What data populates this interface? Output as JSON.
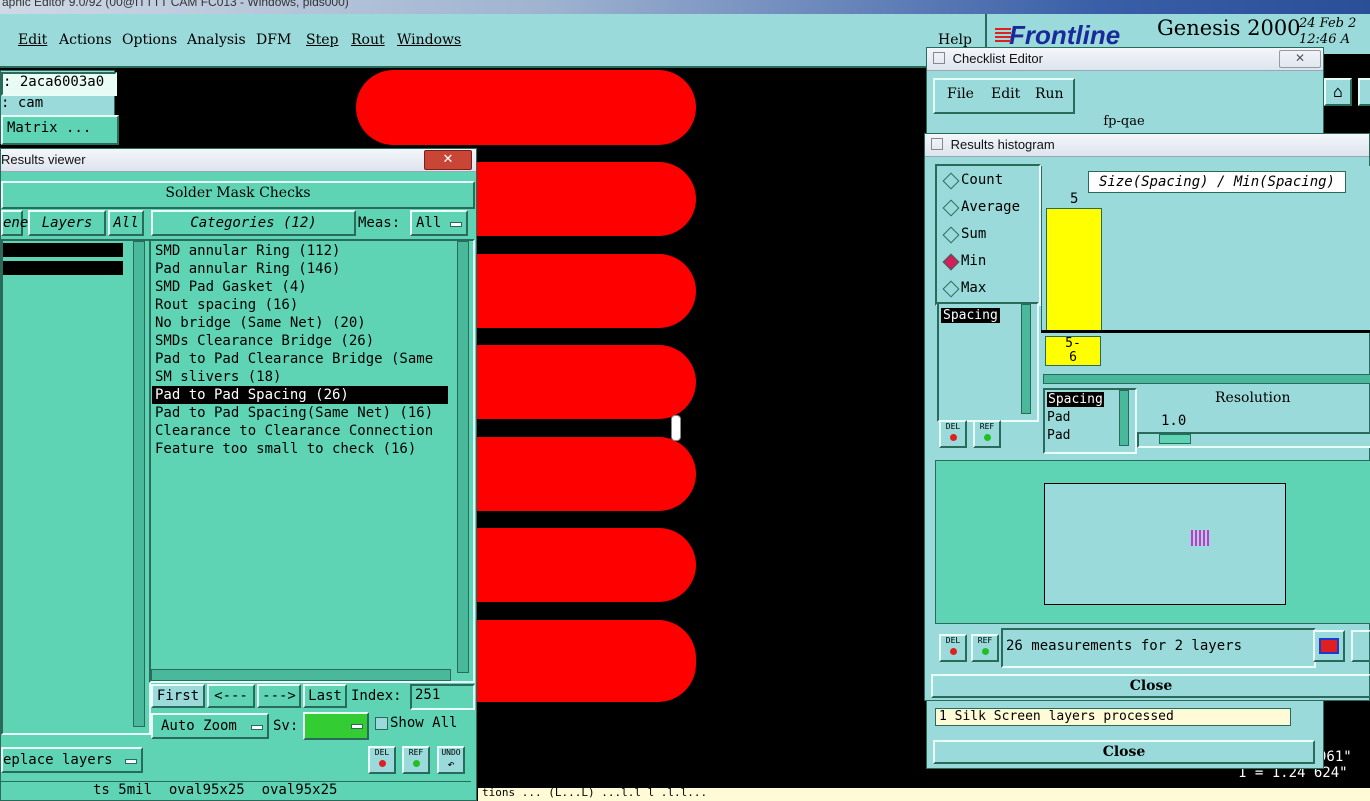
{
  "app": {
    "window_title": "aphic Editor 9.0/92 (00@ITTTT CAM FC013 - Windows, plds000)",
    "menu": [
      "Edit",
      "Actions",
      "Options",
      "Analysis",
      "DFM",
      "Step",
      "Rout",
      "Windows",
      "Help"
    ],
    "job_field": ": 2aca6003a0",
    "user_field": ": cam",
    "matrix_label": "Matrix ...",
    "brand": "Frontline",
    "product": "Genesis 2000",
    "date": "24 Feb 2",
    "time": "12:46 A",
    "coord_1": "961\"",
    "coord_2": "1 = 1.24 624\"",
    "bottom_strip": "tions ... (L...L) ...l.l l .l.l..."
  },
  "results_viewer": {
    "title": "Results viewer",
    "heading": "Solder Mask Checks",
    "left_tab_partial": "ene",
    "layers_tab": "Layers",
    "all_tab": "All",
    "categories_label": "Categories (12)",
    "meas_label": "Meas:",
    "meas_value": "All",
    "categories": [
      "SMD annular Ring (112)",
      "Pad annular Ring (146)",
      "SMD Pad Gasket (4)",
      "Rout spacing (16)",
      "No bridge (Same Net) (20)",
      "SMDs Clearance Bridge (26)",
      "Pad to Pad Clearance Bridge (Same",
      "SM slivers (18)",
      "Pad to Pad Spacing (26)",
      "Pad to Pad Spacing(Same Net) (16)",
      "Clearance to Clearance Connection",
      "Feature too small to check (16)"
    ],
    "selected_index": 8,
    "first_btn": "First",
    "prev_btn": "<---",
    "next_btn": "--->",
    "last_btn": "Last",
    "index_label": "Index:",
    "index_value": "251",
    "auto_zoom": "Auto Zoom",
    "sv_label": "Sv:",
    "show_all": "Show All",
    "replace_layers": "eplace layers",
    "del": "DEL",
    "ref": "REF",
    "undo": "UNDO",
    "status": "ts 5mil  oval95x25  oval95x25"
  },
  "checklist_editor": {
    "title": "Checklist Editor",
    "menu": [
      "File",
      "Edit",
      "Run"
    ],
    "name": "fp-qae",
    "message": "1 Silk Screen layers processed",
    "close": "Close"
  },
  "histogram": {
    "title": "Results histogram",
    "modes": [
      "Count",
      "Average",
      "Sum",
      "Min",
      "Max"
    ],
    "selected_mode": "Min",
    "chart_title": "Size(Spacing) / Min(Spacing)",
    "bar_value": "5",
    "bin_label": "5-\n6",
    "measure_list": [
      "Spacing"
    ],
    "layer_list": [
      "Spacing",
      "Pad",
      "Pad"
    ],
    "resolution_label": "Resolution",
    "resolution_value": "1.0",
    "measurements": "26 measurements for 2 layers",
    "close": "Close",
    "del": "DEL",
    "ref": "REF"
  },
  "colors": {
    "pad_red": "#ff0000",
    "panel_teal": "#5fd4b4",
    "panel_cyan": "#9adada",
    "bar_yellow": "#ffff00",
    "sv_green": "#33cc33"
  }
}
